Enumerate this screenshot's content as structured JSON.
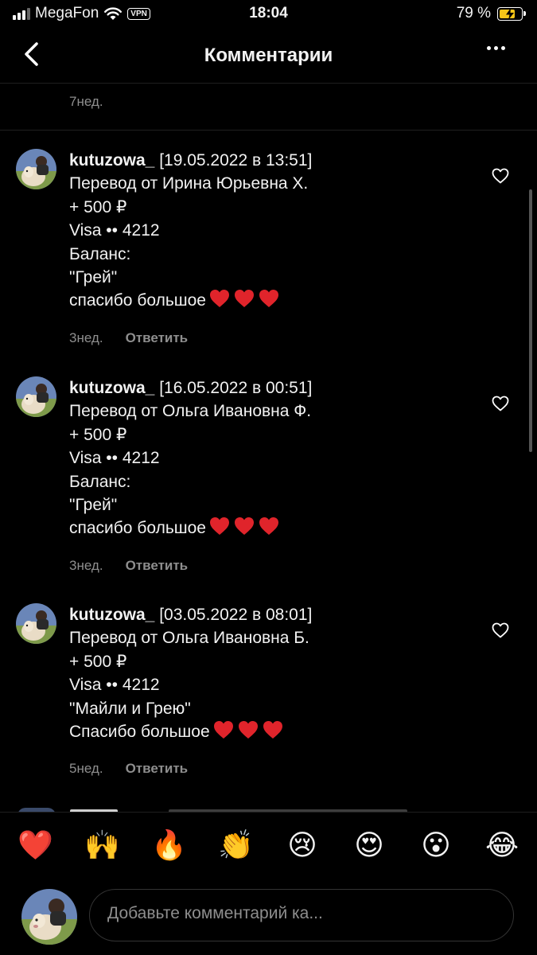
{
  "status_bar": {
    "carrier": "MegaFon",
    "vpn": "VPN",
    "time": "18:04",
    "battery": "79 %",
    "battery_level": 0.79,
    "battery_color": "#f5c518"
  },
  "header": {
    "title": "Комментарии",
    "back_icon": "chevron-left-icon",
    "more_icon": "more-horizontal-icon"
  },
  "previous_comment": {
    "time": "7нед."
  },
  "comments": [
    {
      "username": "kutuzowa_",
      "date": "[19.05.2022 в 13:51]",
      "lines": [
        "Перевод от Ирина Юрьевна Х.",
        "+ 500 ₽",
        "Visa •• 4212",
        "Баланс:",
        "\"Грей\""
      ],
      "last_line": "спасибо большое",
      "hearts": 3,
      "time": "3нед.",
      "reply": "Ответить"
    },
    {
      "username": "kutuzowa_",
      "date": "[16.05.2022 в 00:51]",
      "lines": [
        "Перевод от Ольга Ивановна Ф.",
        "+ 500 ₽",
        "Visa •• 4212",
        "Баланс:",
        "\"Грей\""
      ],
      "last_line": "спасибо большое",
      "hearts": 3,
      "time": "3нед.",
      "reply": "Ответить"
    },
    {
      "username": "kutuzowa_",
      "date": "[03.05.2022 в 08:01]",
      "lines": [
        "Перевод от Ольга Ивановна Б.",
        "+ 500 ₽",
        "Visa •• 4212",
        "\"Майли и Грею\""
      ],
      "last_line": "Спасибо большое",
      "hearts": 3,
      "time": "5нед.",
      "reply": "Ответить"
    }
  ],
  "emoji_bar": [
    {
      "name": "red-heart-emoji",
      "char": "❤️"
    },
    {
      "name": "raising-hands-emoji",
      "char": "🙌"
    },
    {
      "name": "fire-emoji",
      "char": "🔥"
    },
    {
      "name": "clapping-hands-emoji",
      "char": "👏"
    },
    {
      "name": "crying-face-emoji",
      "char": "😢"
    },
    {
      "name": "heart-eyes-emoji",
      "char": "😍"
    },
    {
      "name": "surprised-face-emoji",
      "char": "😮"
    },
    {
      "name": "tears-of-joy-emoji",
      "char": "😂"
    }
  ],
  "composer": {
    "placeholder": "Добавьте комментарий ка..."
  },
  "colors": {
    "background": "#000000",
    "text": "#f2f2f2",
    "secondary_text": "#8e8e8e",
    "heart": "#e0242b"
  }
}
